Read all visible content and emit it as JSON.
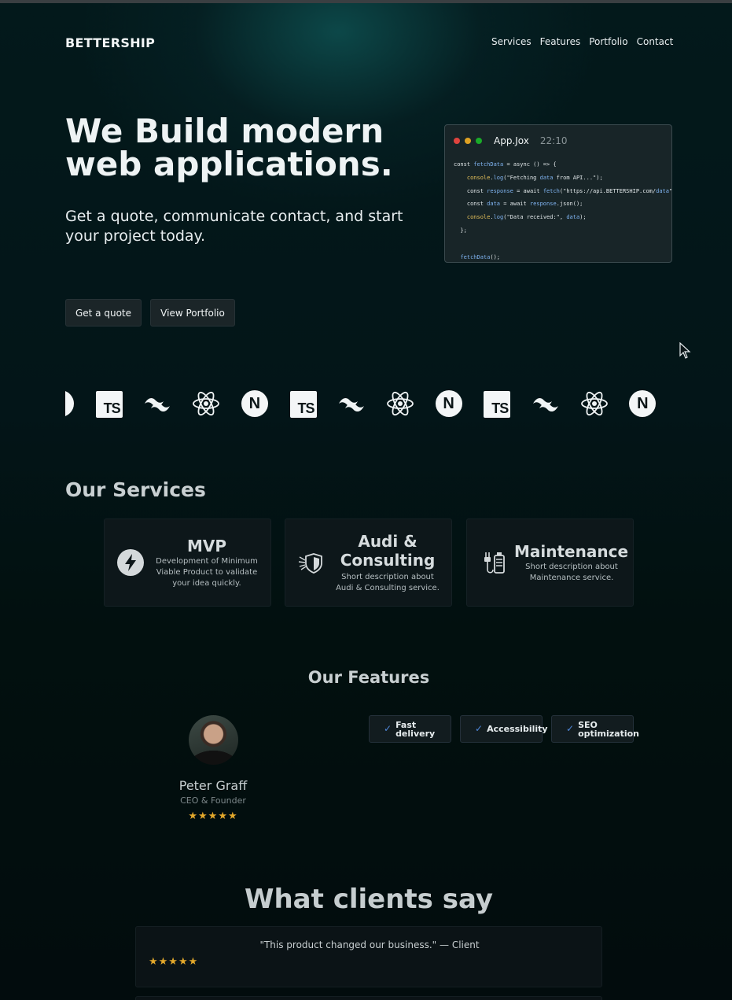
{
  "header": {
    "brand": "BETTERSHIP",
    "nav": [
      "Services",
      "Features",
      "Portfolio",
      "Contact"
    ]
  },
  "hero": {
    "title": "We Build modern web applications.",
    "subtitle": "Get a quote, communicate contact, and start your project today.",
    "primary_button": "Get a quote",
    "secondary_button": "View Portfolio"
  },
  "code_window": {
    "filename": "App.Jox",
    "time": "22:10",
    "dot_colors": [
      "#e0443e",
      "#dea123",
      "#1aab29"
    ],
    "lines": [
      "const fetchData = async () => {",
      "    console.log(\"Fetching data from API...\");",
      "    const response = await fetch(\"https://api.BETTERSHIP.com/data\");",
      "    const data = await response.json();",
      "    console.log(\"Data received:\", data);",
      "  };",
      "",
      "  fetchData();"
    ]
  },
  "tech_logos": [
    "nextjs-icon",
    "typescript-icon",
    "tailwind-icon",
    "react-icon",
    "nextjs-icon",
    "typescript-icon",
    "tailwind-icon",
    "react-icon",
    "nextjs-icon",
    "typescript-icon",
    "tailwind-icon",
    "react-icon",
    "nextjs-icon"
  ],
  "tech_text": {
    "ts": "TS",
    "next": "N"
  },
  "services": {
    "title": "Our Services",
    "items": [
      {
        "icon": "lightning-icon",
        "title": "MVP",
        "description": "Development of Minimum Viable Product to validate your idea quickly."
      },
      {
        "icon": "shield-icon",
        "title": "Audi & Consulting",
        "description": "Short description about Audi & Consulting service."
      },
      {
        "icon": "plug-battery-icon",
        "title": "Maintenance",
        "description": "Short description about Maintenance service."
      }
    ]
  },
  "features": {
    "title": "Our Features",
    "person": {
      "name": "Peter Graff",
      "role": "CEO & Founder",
      "stars": "★★★★★"
    },
    "items": [
      "Fast delivery",
      "Accessibility",
      "SEO optimization"
    ]
  },
  "clients": {
    "title": "What clients say",
    "review": {
      "quote": "\"This product changed our business.\" — Client",
      "stars": "★★★★★"
    }
  },
  "colors": {
    "accent": "#4f86d8",
    "star": "#e3a82b",
    "background": "#031518"
  }
}
